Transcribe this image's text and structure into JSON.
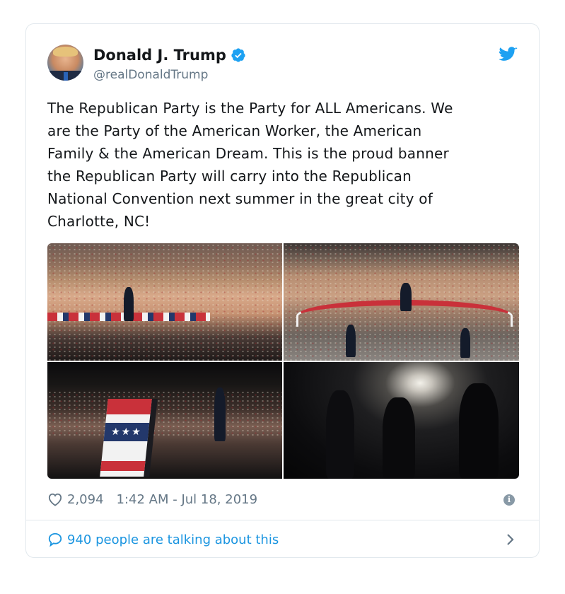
{
  "tweet": {
    "author_name": "Donald J. Trump",
    "author_handle": "@realDonaldTrump",
    "text_lines": [
      "The Republican Party is the Party for ALL Americans. We",
      "are the Party of the American Worker, the American",
      "Family & the American Dream. This is the proud banner",
      "the Republican Party will carry into the Republican",
      "National Convention next summer in the great city of",
      "Charlotte, NC!"
    ],
    "likes": "2,094",
    "timestamp": "1:42 AM - Jul 18, 2019",
    "talking": "940 people are talking about this"
  },
  "icons": {
    "verified": "verified-badge-icon",
    "brand": "twitter-bird-icon",
    "like": "heart-icon",
    "info": "info-icon",
    "reply": "speech-bubble-icon",
    "more": "chevron-right-icon"
  },
  "colors": {
    "twitter_blue": "#1da1f2",
    "link_blue": "#1b95e0",
    "text_primary": "#14171a",
    "text_secondary": "#657786",
    "border": "#e1e8ed"
  }
}
